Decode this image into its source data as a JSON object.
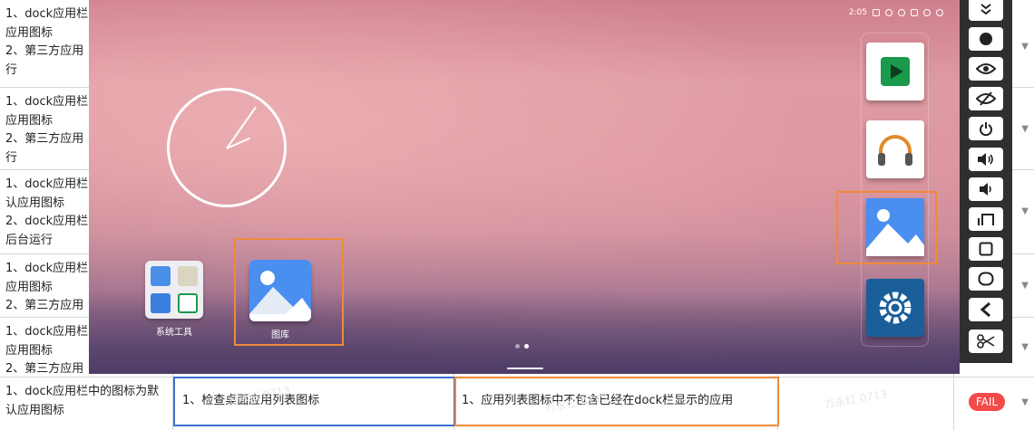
{
  "sheet": {
    "rows": [
      {
        "col1": "1、dock应用栏\n应用图标\n2、第三方应用\n行",
        "col2": "",
        "col3": "",
        "col4": ""
      },
      {
        "col1": "1、dock应用栏\n应用图标\n2、第三方应用\n行",
        "col2": "",
        "col3": "",
        "col4": ""
      },
      {
        "col1": "1、dock应用栏\n认应用图标\n2、dock应用栏\n后台运行",
        "col2": "",
        "col3": "",
        "col4": ""
      },
      {
        "col1": "1、dock应用栏\n应用图标\n2、第三方应用",
        "col2": "",
        "col3": "",
        "col4": ""
      },
      {
        "col1": "1、dock应用栏\n应用图标\n2、第三方应用",
        "col2": "",
        "col3": "",
        "col4": ""
      },
      {
        "col1": "1、dock应用栏中的图标为默\n认应用图标",
        "col2": "1、检查桌面应用列表图标",
        "col3": "1、应用列表图标中不包含已经在dock栏显示的应用",
        "col4": ""
      }
    ],
    "status_fail": "FAIL",
    "watermark": "方永红 0713",
    "dropdown_arrow": "▼"
  },
  "android": {
    "status_time": "2:05",
    "desktop_apps": [
      {
        "label": "系统工具",
        "icon": "folder-icon"
      },
      {
        "label": "图库",
        "icon": "gallery-icon"
      }
    ],
    "dock_apps": [
      {
        "icon": "play-store-icon"
      },
      {
        "icon": "music-icon"
      },
      {
        "icon": "gallery-icon"
      },
      {
        "icon": "settings-icon"
      }
    ]
  },
  "toolbar": {
    "buttons": [
      {
        "icon": "collapse-icon"
      },
      {
        "icon": "record-icon"
      },
      {
        "icon": "eye-icon"
      },
      {
        "icon": "eye-off-icon"
      },
      {
        "icon": "power-icon"
      },
      {
        "icon": "volume-up-icon"
      },
      {
        "icon": "volume-down-icon"
      },
      {
        "icon": "rotate-icon"
      },
      {
        "icon": "home-square-icon"
      },
      {
        "icon": "recent-round-icon"
      },
      {
        "icon": "back-icon"
      },
      {
        "icon": "screenshot-scissors-icon"
      }
    ]
  },
  "colors": {
    "fail": "#f34a4a",
    "highlight_orange": "#f08a3a",
    "highlight_blue": "#3b6fd0",
    "toolbar_bg": "#2f2f2f"
  }
}
